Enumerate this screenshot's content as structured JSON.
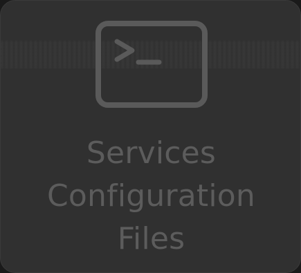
{
  "tile": {
    "icon": "terminal-icon",
    "label_lines": [
      "Services",
      "Configuration",
      "Files"
    ]
  },
  "colors": {
    "background": "#303030",
    "foreground": "#5c5c5c"
  }
}
